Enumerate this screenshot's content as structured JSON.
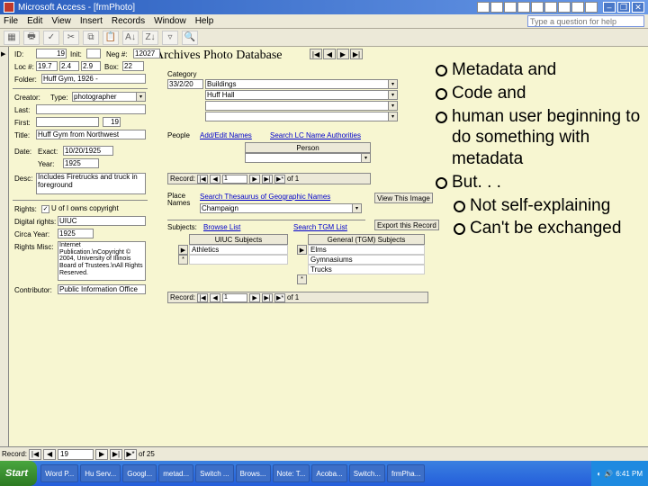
{
  "titlebar": {
    "title": "Microsoft Access - [frmPhoto]"
  },
  "mini_toolbar": [
    "A",
    "X",
    "W",
    "✓",
    "N",
    "P",
    "S",
    "✎",
    "A"
  ],
  "winctl": [
    "–",
    "❐",
    "✕"
  ],
  "menu": [
    "File",
    "Edit",
    "View",
    "Insert",
    "Records",
    "Window",
    "Help"
  ],
  "ask_placeholder": "Type a question for help",
  "banner": "Archives Photo Database",
  "form": {
    "id_lbl": "ID:",
    "id": "19",
    "init_lbl": "Init:",
    "neg_lbl": "Neg #:",
    "neg": "12027",
    "loc_lbl": "Loc #:",
    "loc1": "19.7",
    "loc2": "2.4",
    "loc3": "2.9",
    "box_lbl": "Box:",
    "boxv": "22",
    "folder_lbl": "Folder:",
    "folder": "Huff Gym, 1926 -",
    "creator_lbl": "Creator:",
    "creator_type_lbl": "Type:",
    "creator_type": "photographer",
    "last_lbl": "Last:",
    "first_lbl": "First:",
    "first": "19",
    "title_lbl": "Title:",
    "title": "Huff Gym from Northwest",
    "date_lbl": "Date:",
    "exact_lbl": "Exact:",
    "exact": "10/20/1925",
    "year_lbl": "Year:",
    "year": "1925",
    "desc_lbl": "Desc:",
    "desc": "Includes Firetrucks and truck in foreground",
    "rights_lbl": "Rights:",
    "rights_chk": "✓",
    "rights_txt": "U of I owns copyright",
    "digitalrights_lbl": "Digital rights:",
    "digitalrights": "UIUC",
    "circayear_lbl": "Circa Year:",
    "circayear": "1925",
    "rightsmisc_lbl": "Rights Misc:",
    "rightsmisc": "Internet Publication.\\nCopyright © 2004, University of Illinois Board of Trustees.\\nAll Rights Reserved.",
    "contributor_lbl": "Contributor:",
    "contributor": "Public Information Office"
  },
  "cat": {
    "label": "Category",
    "row1": "33/2/20",
    "row1b": "Buildings",
    "row2": "Huff Hall"
  },
  "people": {
    "label": "People",
    "addedit": "Add/Edit Names",
    "search": "Search LC Name Authorities",
    "person": "Person"
  },
  "places": {
    "label": "Place Names",
    "search": "Search Thesaurus of Geographic Names",
    "val": "Champaign"
  },
  "subjects": {
    "label": "Subjects:",
    "browse": "Browse List",
    "search": "Search TGM List",
    "col1": "UIUC Subjects",
    "col2": "General (TGM) Subjects",
    "c1v": "Athletics",
    "c2": [
      "Elms",
      "Gymnasiums",
      "Trucks"
    ]
  },
  "buttons": {
    "view": "View This Image",
    "export": "Export this Record"
  },
  "subrec": {
    "label": "Record:",
    "of": "of"
  },
  "main_rec": {
    "label": "Record:",
    "val": "19",
    "total": "of  25"
  },
  "taskbar": {
    "start": "Start",
    "tasks": [
      "Word P...",
      "Hu Serv...",
      "Googl...",
      "metad...",
      "Switch ...",
      "Brows...",
      "Note: T...",
      "Acoba...",
      "Switch...",
      "frmPha..."
    ],
    "time": "6:41 PM"
  },
  "overlay": {
    "items": [
      "Metadata and",
      "Code and",
      "human user beginning to do something with metadata",
      "But. . ."
    ],
    "sub": [
      " Not self-explaining",
      "Can't be exchanged"
    ]
  }
}
